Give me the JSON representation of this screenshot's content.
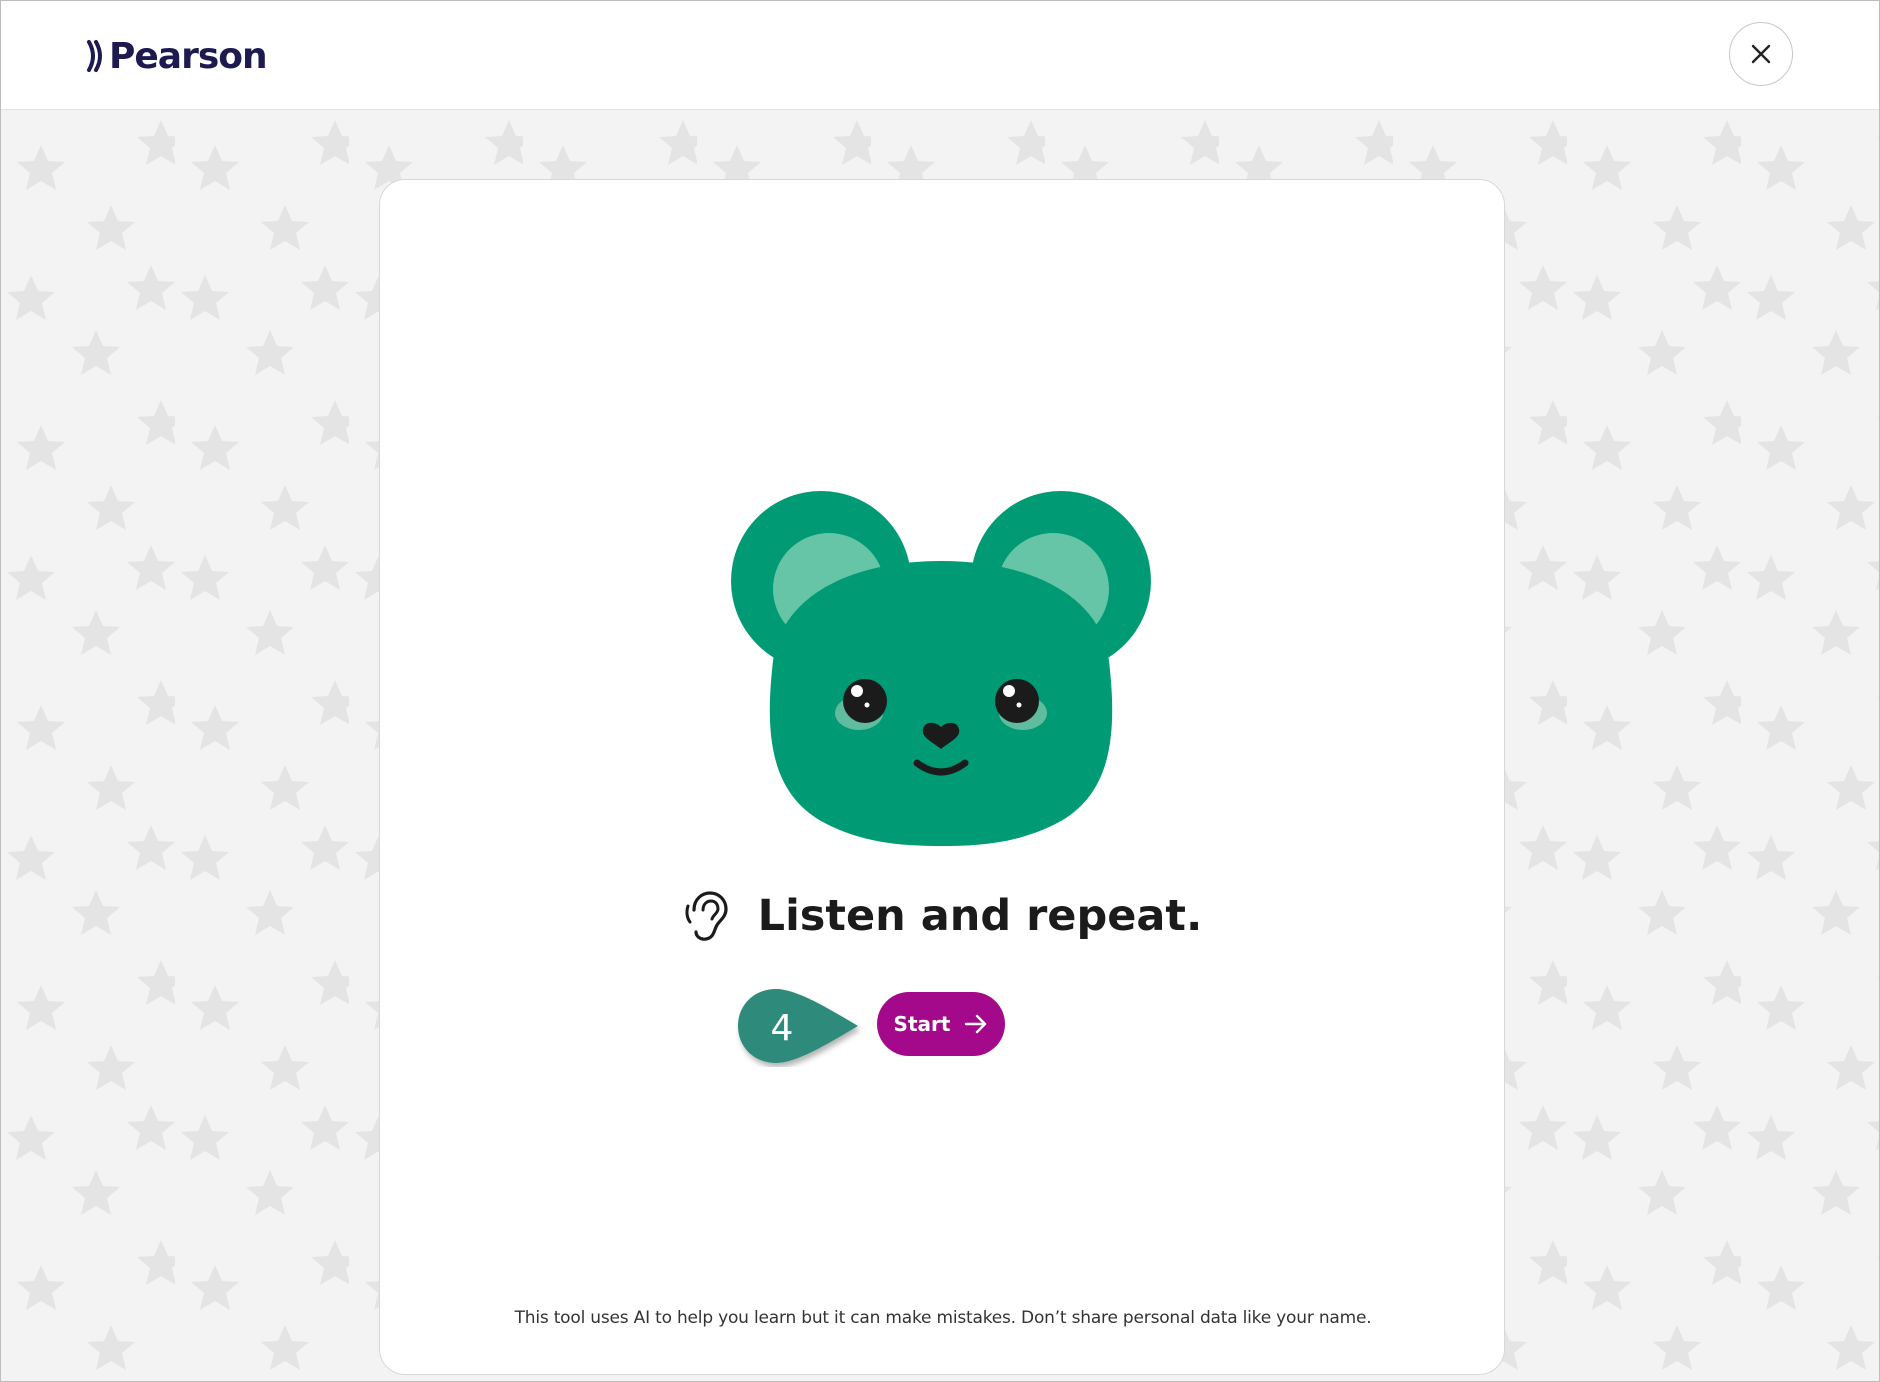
{
  "header": {
    "logo_text": "Pearson",
    "close_icon": "close-icon"
  },
  "card": {
    "illustration": "bear-face",
    "title_icon": "ear-icon",
    "title": "Listen and repeat.",
    "step_callout": "4",
    "start_button": {
      "label": "Start",
      "icon": "arrow-right-icon"
    },
    "disclaimer": "This tool uses AI to help you learn but it can make mistakes. Don’t share personal data like your name."
  },
  "colors": {
    "brand_text": "#1c1a4f",
    "bear_green": "#009b74",
    "bear_light": "#66c4a7",
    "start_button": "#a3098a",
    "callout_teal": "#2f8a7a",
    "background": "#f3f3f3"
  }
}
